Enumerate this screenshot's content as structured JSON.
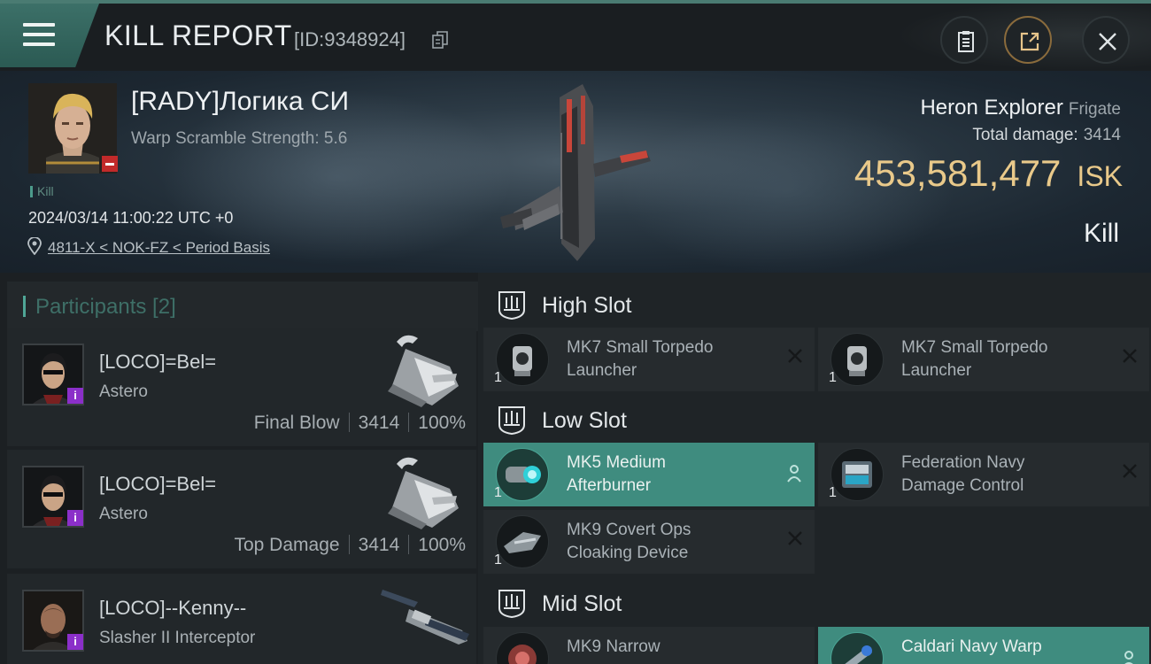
{
  "header": {
    "title": "KILL REPORT",
    "kill_id": "[ID:9348924]"
  },
  "victim": {
    "name": "[RADY]Логика СИ",
    "warp_scramble": "Warp Scramble Strength: 5.6",
    "tag": "Kill",
    "timestamp": "2024/03/14 11:00:22 UTC +0",
    "location": "4811-X < NOK-FZ < Period Basis",
    "ship_name": "Heron Explorer",
    "ship_class": "Frigate",
    "total_damage_label": "Total damage:",
    "total_damage": "3414",
    "isk_value": "453,581,477",
    "isk_unit": "ISK",
    "result": "Kill"
  },
  "participants": {
    "header": "Participants [2]",
    "items": [
      {
        "name": "[LOCO]=Bel=",
        "ship": "Astero",
        "role": "Final Blow",
        "damage": "3414",
        "percent": "100%"
      },
      {
        "name": "[LOCO]=Bel=",
        "ship": "Astero",
        "role": "Top Damage",
        "damage": "3414",
        "percent": "100%"
      },
      {
        "name": "[LOCO]--Kenny--",
        "ship": "Slasher II Interceptor"
      }
    ]
  },
  "fitting": {
    "high_slot": {
      "label": "High Slot",
      "modules": [
        {
          "line1": "MK7 Small Torpedo",
          "line2": "Launcher",
          "qty": "1"
        },
        {
          "line1": "MK7 Small Torpedo",
          "line2": "Launcher",
          "qty": "1"
        }
      ]
    },
    "low_slot": {
      "label": "Low Slot",
      "modules": [
        {
          "line1": "MK5 Medium",
          "line2": "Afterburner",
          "qty": "1"
        },
        {
          "line1": "Federation Navy",
          "line2": "Damage Control",
          "qty": "1"
        },
        {
          "line1": "MK9 Covert Ops",
          "line2": "Cloaking Device",
          "qty": "1"
        }
      ]
    },
    "mid_slot": {
      "label": "Mid Slot",
      "modules": [
        {
          "line1": "MK9 Narrow",
          "line2": ""
        },
        {
          "line1": "Caldari Navy Warp",
          "line2": ""
        }
      ]
    }
  },
  "colors": {
    "accent": "#3f8c7f",
    "isk": "#e9c98a",
    "badge_red": "#c22a2a",
    "badge_purple": "#8b2fc9"
  },
  "icons": [
    "menu-icon",
    "copy-icon",
    "clipboard-icon",
    "share-icon",
    "close-icon",
    "pin-icon",
    "slot-icon",
    "remove-icon",
    "person-icon"
  ]
}
